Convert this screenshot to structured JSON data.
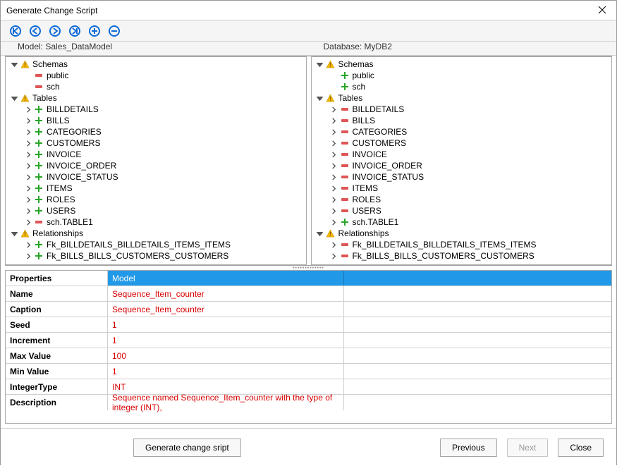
{
  "window": {
    "title": "Generate Change Script"
  },
  "labels": {
    "model": "Model:",
    "database": "Database:"
  },
  "model_name": "Sales_DataModel",
  "database_name": "MyDB2",
  "left_tree": [
    {
      "indent": 0,
      "chev": "open",
      "icon": "warn",
      "label": "Schemas"
    },
    {
      "indent": 1,
      "chev": "none",
      "icon": "minus",
      "label": "public"
    },
    {
      "indent": 1,
      "chev": "none",
      "icon": "minus",
      "label": "sch"
    },
    {
      "indent": 0,
      "chev": "open",
      "icon": "warn",
      "label": "Tables"
    },
    {
      "indent": 1,
      "chev": "right",
      "icon": "plus",
      "label": "BILLDETAILS"
    },
    {
      "indent": 1,
      "chev": "right",
      "icon": "plus",
      "label": "BILLS"
    },
    {
      "indent": 1,
      "chev": "right",
      "icon": "plus",
      "label": "CATEGORIES"
    },
    {
      "indent": 1,
      "chev": "right",
      "icon": "plus",
      "label": "CUSTOMERS"
    },
    {
      "indent": 1,
      "chev": "right",
      "icon": "plus",
      "label": "INVOICE"
    },
    {
      "indent": 1,
      "chev": "right",
      "icon": "plus",
      "label": "INVOICE_ORDER"
    },
    {
      "indent": 1,
      "chev": "right",
      "icon": "plus",
      "label": "INVOICE_STATUS"
    },
    {
      "indent": 1,
      "chev": "right",
      "icon": "plus",
      "label": "ITEMS"
    },
    {
      "indent": 1,
      "chev": "right",
      "icon": "plus",
      "label": "ROLES"
    },
    {
      "indent": 1,
      "chev": "right",
      "icon": "plus",
      "label": "USERS"
    },
    {
      "indent": 1,
      "chev": "right",
      "icon": "minus",
      "label": "sch.TABLE1"
    },
    {
      "indent": 0,
      "chev": "open",
      "icon": "warn",
      "label": "Relationships"
    },
    {
      "indent": 1,
      "chev": "right",
      "icon": "plus",
      "label": "Fk_BILLDETAILS_BILLDETAILS_ITEMS_ITEMS"
    },
    {
      "indent": 1,
      "chev": "right",
      "icon": "plus",
      "label": "Fk_BILLS_BILLS_CUSTOMERS_CUSTOMERS"
    }
  ],
  "right_tree": [
    {
      "indent": 0,
      "chev": "open",
      "icon": "warn",
      "label": "Schemas"
    },
    {
      "indent": 1,
      "chev": "none",
      "icon": "plus",
      "label": "public"
    },
    {
      "indent": 1,
      "chev": "none",
      "icon": "plus",
      "label": "sch"
    },
    {
      "indent": 0,
      "chev": "open",
      "icon": "warn",
      "label": "Tables"
    },
    {
      "indent": 1,
      "chev": "right",
      "icon": "minus",
      "label": "BILLDETAILS"
    },
    {
      "indent": 1,
      "chev": "right",
      "icon": "minus",
      "label": "BILLS"
    },
    {
      "indent": 1,
      "chev": "right",
      "icon": "minus",
      "label": "CATEGORIES"
    },
    {
      "indent": 1,
      "chev": "right",
      "icon": "minus",
      "label": "CUSTOMERS"
    },
    {
      "indent": 1,
      "chev": "right",
      "icon": "minus",
      "label": "INVOICE"
    },
    {
      "indent": 1,
      "chev": "right",
      "icon": "minus",
      "label": "INVOICE_ORDER"
    },
    {
      "indent": 1,
      "chev": "right",
      "icon": "minus",
      "label": "INVOICE_STATUS"
    },
    {
      "indent": 1,
      "chev": "right",
      "icon": "minus",
      "label": "ITEMS"
    },
    {
      "indent": 1,
      "chev": "right",
      "icon": "minus",
      "label": "ROLES"
    },
    {
      "indent": 1,
      "chev": "right",
      "icon": "minus",
      "label": "USERS"
    },
    {
      "indent": 1,
      "chev": "right",
      "icon": "plus",
      "label": "sch.TABLE1"
    },
    {
      "indent": 0,
      "chev": "open",
      "icon": "warn",
      "label": "Relationships"
    },
    {
      "indent": 1,
      "chev": "right",
      "icon": "minus",
      "label": "Fk_BILLDETAILS_BILLDETAILS_ITEMS_ITEMS"
    },
    {
      "indent": 1,
      "chev": "right",
      "icon": "minus",
      "label": "Fk_BILLS_BILLS_CUSTOMERS_CUSTOMERS"
    }
  ],
  "properties": {
    "header_label": "Properties",
    "header_model": "Model",
    "header_db": "",
    "rows": [
      {
        "label": "Name",
        "model": "Sequence_Item_counter",
        "db": ""
      },
      {
        "label": "Caption",
        "model": "Sequence_Item_counter",
        "db": ""
      },
      {
        "label": "Seed",
        "model": "1",
        "db": ""
      },
      {
        "label": "Increment",
        "model": "1",
        "db": ""
      },
      {
        "label": "Max Value",
        "model": "100",
        "db": ""
      },
      {
        "label": "Min Value",
        "model": "1",
        "db": ""
      },
      {
        "label": "IntegerType",
        "model": "INT",
        "db": ""
      },
      {
        "label": "Description",
        "model": "Sequence named Sequence_Item_counter with the type of integer (INT),",
        "db": ""
      }
    ]
  },
  "footer": {
    "generate": "Generate change sript",
    "previous": "Previous",
    "next": "Next",
    "close": "Close"
  }
}
